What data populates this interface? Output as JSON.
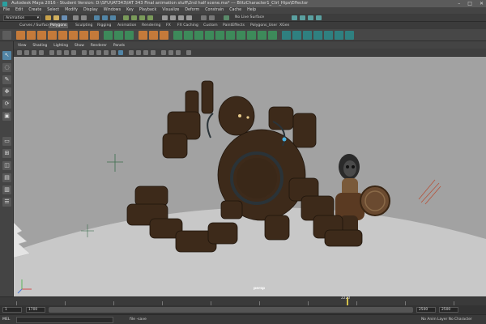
{
  "window": {
    "title": "Autodesk Maya 2016 - Student Version: D:\\SFU\\IAT343\\IAT 343 Final animation stuff\\2nd half scene.ma*  ---  BlitzCharacter1_Ctrl_Hips\\Effector",
    "controls": [
      "–",
      "□",
      "✕"
    ]
  },
  "menubar": [
    "File",
    "Edit",
    "Create",
    "Select",
    "Modify",
    "Display",
    "Windows",
    "Key",
    "Playback",
    "Visualize",
    "Deform",
    "Constrain",
    "Cache",
    "Help"
  ],
  "statusline": {
    "mode": "Animation",
    "live_surface": "No Live Surface"
  },
  "shelf_tabs": [
    {
      "label": "Curves / Surfaces",
      "active": false
    },
    {
      "label": "Polygons",
      "active": true
    },
    {
      "label": "Sculpting",
      "active": false
    },
    {
      "label": "Rigging",
      "active": false
    },
    {
      "label": "Animation",
      "active": false
    },
    {
      "label": "Rendering",
      "active": false
    },
    {
      "label": "FX",
      "active": false
    },
    {
      "label": "FX Caching",
      "active": false
    },
    {
      "label": "Custom",
      "active": false
    },
    {
      "label": "PaintEffects",
      "active": false
    },
    {
      "label": "Polygons_User",
      "active": false
    },
    {
      "label": "XGen",
      "active": false
    }
  ],
  "panel_menu": [
    "View",
    "Shading",
    "Lighting",
    "Show",
    "Renderer",
    "Panels"
  ],
  "viewport": {
    "camera_label": "persp"
  },
  "timeline": {
    "current_frame": "2220",
    "range_start": "1",
    "range_inner_start": "1700",
    "range_inner_end": "2500",
    "range_end": "2500"
  },
  "commandline": {
    "language": "MEL",
    "output": "file -save",
    "right_info": "No Anim Layer   No Character"
  },
  "colors": {
    "accent_blue": "#5285a6",
    "robot_body": "#3d2a1a",
    "viewport_bg": "#a2a2a2",
    "ground": "#c8c8c8"
  }
}
